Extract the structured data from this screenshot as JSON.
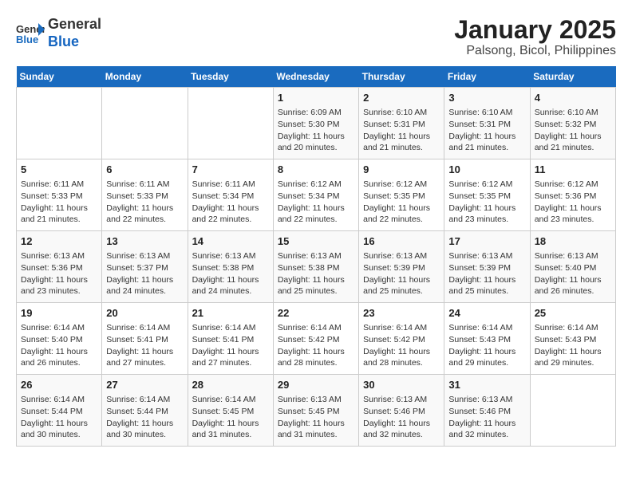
{
  "header": {
    "logo_line1": "General",
    "logo_line2": "Blue",
    "title": "January 2025",
    "subtitle": "Palsong, Bicol, Philippines"
  },
  "weekdays": [
    "Sunday",
    "Monday",
    "Tuesday",
    "Wednesday",
    "Thursday",
    "Friday",
    "Saturday"
  ],
  "weeks": [
    [
      {
        "day": "",
        "info": ""
      },
      {
        "day": "",
        "info": ""
      },
      {
        "day": "",
        "info": ""
      },
      {
        "day": "1",
        "info": "Sunrise: 6:09 AM\nSunset: 5:30 PM\nDaylight: 11 hours\nand 20 minutes."
      },
      {
        "day": "2",
        "info": "Sunrise: 6:10 AM\nSunset: 5:31 PM\nDaylight: 11 hours\nand 21 minutes."
      },
      {
        "day": "3",
        "info": "Sunrise: 6:10 AM\nSunset: 5:31 PM\nDaylight: 11 hours\nand 21 minutes."
      },
      {
        "day": "4",
        "info": "Sunrise: 6:10 AM\nSunset: 5:32 PM\nDaylight: 11 hours\nand 21 minutes."
      }
    ],
    [
      {
        "day": "5",
        "info": "Sunrise: 6:11 AM\nSunset: 5:33 PM\nDaylight: 11 hours\nand 21 minutes."
      },
      {
        "day": "6",
        "info": "Sunrise: 6:11 AM\nSunset: 5:33 PM\nDaylight: 11 hours\nand 22 minutes."
      },
      {
        "day": "7",
        "info": "Sunrise: 6:11 AM\nSunset: 5:34 PM\nDaylight: 11 hours\nand 22 minutes."
      },
      {
        "day": "8",
        "info": "Sunrise: 6:12 AM\nSunset: 5:34 PM\nDaylight: 11 hours\nand 22 minutes."
      },
      {
        "day": "9",
        "info": "Sunrise: 6:12 AM\nSunset: 5:35 PM\nDaylight: 11 hours\nand 22 minutes."
      },
      {
        "day": "10",
        "info": "Sunrise: 6:12 AM\nSunset: 5:35 PM\nDaylight: 11 hours\nand 23 minutes."
      },
      {
        "day": "11",
        "info": "Sunrise: 6:12 AM\nSunset: 5:36 PM\nDaylight: 11 hours\nand 23 minutes."
      }
    ],
    [
      {
        "day": "12",
        "info": "Sunrise: 6:13 AM\nSunset: 5:36 PM\nDaylight: 11 hours\nand 23 minutes."
      },
      {
        "day": "13",
        "info": "Sunrise: 6:13 AM\nSunset: 5:37 PM\nDaylight: 11 hours\nand 24 minutes."
      },
      {
        "day": "14",
        "info": "Sunrise: 6:13 AM\nSunset: 5:38 PM\nDaylight: 11 hours\nand 24 minutes."
      },
      {
        "day": "15",
        "info": "Sunrise: 6:13 AM\nSunset: 5:38 PM\nDaylight: 11 hours\nand 25 minutes."
      },
      {
        "day": "16",
        "info": "Sunrise: 6:13 AM\nSunset: 5:39 PM\nDaylight: 11 hours\nand 25 minutes."
      },
      {
        "day": "17",
        "info": "Sunrise: 6:13 AM\nSunset: 5:39 PM\nDaylight: 11 hours\nand 25 minutes."
      },
      {
        "day": "18",
        "info": "Sunrise: 6:13 AM\nSunset: 5:40 PM\nDaylight: 11 hours\nand 26 minutes."
      }
    ],
    [
      {
        "day": "19",
        "info": "Sunrise: 6:14 AM\nSunset: 5:40 PM\nDaylight: 11 hours\nand 26 minutes."
      },
      {
        "day": "20",
        "info": "Sunrise: 6:14 AM\nSunset: 5:41 PM\nDaylight: 11 hours\nand 27 minutes."
      },
      {
        "day": "21",
        "info": "Sunrise: 6:14 AM\nSunset: 5:41 PM\nDaylight: 11 hours\nand 27 minutes."
      },
      {
        "day": "22",
        "info": "Sunrise: 6:14 AM\nSunset: 5:42 PM\nDaylight: 11 hours\nand 28 minutes."
      },
      {
        "day": "23",
        "info": "Sunrise: 6:14 AM\nSunset: 5:42 PM\nDaylight: 11 hours\nand 28 minutes."
      },
      {
        "day": "24",
        "info": "Sunrise: 6:14 AM\nSunset: 5:43 PM\nDaylight: 11 hours\nand 29 minutes."
      },
      {
        "day": "25",
        "info": "Sunrise: 6:14 AM\nSunset: 5:43 PM\nDaylight: 11 hours\nand 29 minutes."
      }
    ],
    [
      {
        "day": "26",
        "info": "Sunrise: 6:14 AM\nSunset: 5:44 PM\nDaylight: 11 hours\nand 30 minutes."
      },
      {
        "day": "27",
        "info": "Sunrise: 6:14 AM\nSunset: 5:44 PM\nDaylight: 11 hours\nand 30 minutes."
      },
      {
        "day": "28",
        "info": "Sunrise: 6:14 AM\nSunset: 5:45 PM\nDaylight: 11 hours\nand 31 minutes."
      },
      {
        "day": "29",
        "info": "Sunrise: 6:13 AM\nSunset: 5:45 PM\nDaylight: 11 hours\nand 31 minutes."
      },
      {
        "day": "30",
        "info": "Sunrise: 6:13 AM\nSunset: 5:46 PM\nDaylight: 11 hours\nand 32 minutes."
      },
      {
        "day": "31",
        "info": "Sunrise: 6:13 AM\nSunset: 5:46 PM\nDaylight: 11 hours\nand 32 minutes."
      },
      {
        "day": "",
        "info": ""
      }
    ]
  ]
}
